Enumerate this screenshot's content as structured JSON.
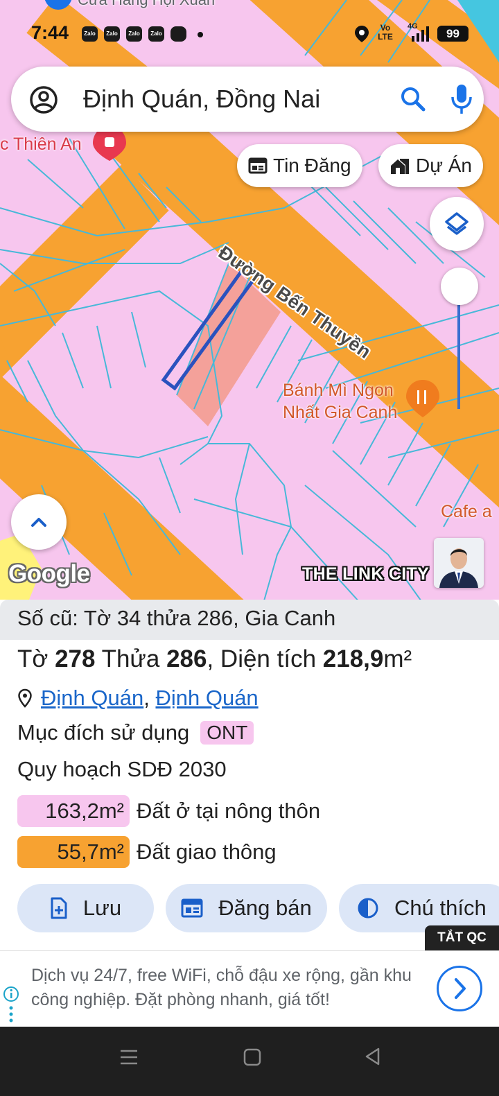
{
  "status_bar": {
    "time": "7:44",
    "notifications": [
      "Zalo",
      "Zalo",
      "Zalo",
      "Zalo"
    ],
    "network": "Vo LTE",
    "signal": "4G",
    "battery": "99"
  },
  "map": {
    "poi_top": "Cửa Hàng Hội Xuân",
    "poi_pharmacy": "c Thiên An",
    "road_name": "Đường Bến Thuyền",
    "poi_bakery_line1": "Bánh Mì Ngon",
    "poi_bakery_line2": "Nhất Gia Canh",
    "poi_cafe": "Cafe a",
    "google_logo": "Google",
    "watermark": "THE LINK CITY",
    "colors": {
      "residential": "#f7c6ee",
      "road": "#f7a231",
      "parcel_lines": "#47b8d8",
      "selected": "#2a52be"
    }
  },
  "search": {
    "text": "Định Quán, Đồng Nai"
  },
  "chips": {
    "listings": "Tin Đăng",
    "projects": "Dự Án"
  },
  "parcel": {
    "old_info": "Số cũ: Tờ 34 thửa 286, Gia Canh",
    "sheet_label": "Tờ",
    "sheet": "278",
    "lot_label": "Thửa",
    "lot": "286",
    "area_label": ", Diện tích",
    "area": "218,9",
    "area_unit": "m²",
    "location_1": "Định Quán",
    "location_sep": ",",
    "location_2": "Định Quán",
    "usage_label": "Mục đích sử dụng",
    "usage_code": "ONT",
    "planning": "Quy hoạch SDĐ 2030",
    "land_uses": [
      {
        "area": "163,2m²",
        "label": "Đất ở tại nông thôn",
        "color": "#f7c6ee"
      },
      {
        "area": "55,7m²",
        "label": "Đất giao thông",
        "color": "#f7a231"
      }
    ]
  },
  "actions": {
    "save": "Lưu",
    "post_sale": "Đăng bán",
    "legend": "Chú thích"
  },
  "ad": {
    "toggle": "TẮT QC",
    "text": "Dịch vụ 24/7, free WiFi, chỗ đậu xe rộng, gần khu công nghiệp. Đặt phòng nhanh, giá tốt!"
  }
}
